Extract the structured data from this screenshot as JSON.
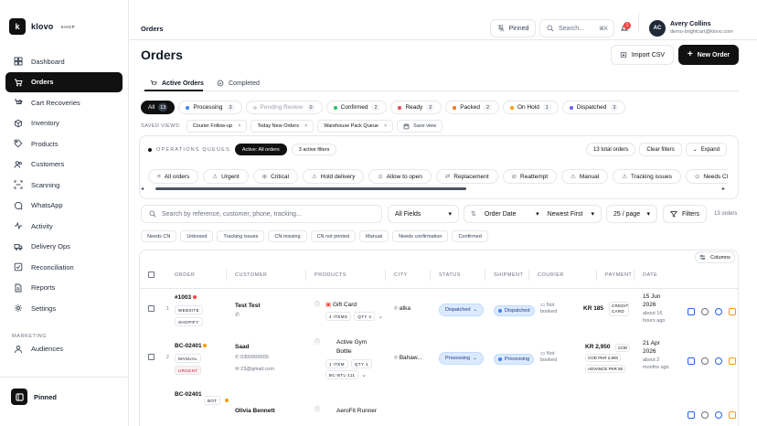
{
  "brand": {
    "name": "klovo",
    "sub": "SHOP",
    "initial": "k"
  },
  "nav": [
    {
      "label": "Dashboard",
      "icon": "grid-icon"
    },
    {
      "label": "Orders",
      "icon": "cart-icon",
      "active": true
    },
    {
      "label": "Cart Recoveries",
      "icon": "cart-recover-icon"
    },
    {
      "label": "Inventory",
      "icon": "box-icon"
    },
    {
      "label": "Products",
      "icon": "tag-icon"
    },
    {
      "label": "Customers",
      "icon": "users-icon"
    },
    {
      "label": "Scanning",
      "icon": "scan-icon"
    },
    {
      "label": "WhatsApp",
      "icon": "chat-icon"
    },
    {
      "label": "Activity",
      "icon": "activity-icon"
    },
    {
      "label": "Delivery Ops",
      "icon": "truck-icon"
    },
    {
      "label": "Reconciliation",
      "icon": "reconcile-icon"
    },
    {
      "label": "Reports",
      "icon": "report-icon"
    },
    {
      "label": "Settings",
      "icon": "gear-icon"
    }
  ],
  "marketing_label": "MARKETING",
  "audiences": "Audiences",
  "pinned_label": "Pinned",
  "topbar": {
    "crumb": "Orders",
    "pinned": "Pinned",
    "search_placeholder": "Search...",
    "shortcut": "⌘K",
    "notif_count": "1",
    "user_name": "Avery Collins",
    "user_email": "demo-brightcart@klovo.com",
    "user_initials": "AC"
  },
  "page": {
    "title": "Orders",
    "import": "Import CSV",
    "new_order": "New Order"
  },
  "tabs": [
    {
      "label": "Active Orders",
      "active": true
    },
    {
      "label": "Completed"
    }
  ],
  "status_pills": [
    {
      "label": "All",
      "count": "13",
      "active": true
    },
    {
      "label": "Processing",
      "count": "3",
      "color": "#3b82f6"
    },
    {
      "label": "Pending Review",
      "count": "0",
      "color": "#d1d5db",
      "faded": true
    },
    {
      "label": "Confirmed",
      "count": "2",
      "color": "#22c55e"
    },
    {
      "label": "Ready",
      "count": "2",
      "color": "#ef4444"
    },
    {
      "label": "Packed",
      "count": "2",
      "color": "#f97316"
    },
    {
      "label": "On Hold",
      "count": "1",
      "color": "#f59e0b"
    },
    {
      "label": "Dispatched",
      "count": "3",
      "color": "#6366f1"
    }
  ],
  "saved_views": {
    "label": "SAVED VIEWS:",
    "views": [
      "Courier Follow-up",
      "Today New Orders",
      "Warehouse Pack Queue"
    ],
    "save": "Save view"
  },
  "queues": {
    "label": "OPERATIONS QUEUES",
    "active": "Active: All orders",
    "filters": "3 active filters",
    "total": "13 total orders",
    "clear": "Clear filters",
    "expand": "Expand",
    "chips": [
      "All orders",
      "Urgent",
      "Critical",
      "Hold delivery",
      "Allow to open",
      "Replacement",
      "Reattempt",
      "Manual",
      "Tracking issues",
      "Needs CN"
    ]
  },
  "search": {
    "placeholder": "Search by reference, customer, phone, tracking...",
    "fields": "All Fields",
    "sort": "Order Date",
    "order": "Newest First",
    "per_page": "25 / page",
    "filters": "Filters",
    "count": "13 orders"
  },
  "quick_filters": [
    "Needs CN",
    "Unboxed",
    "Tracking issues",
    "CN missing",
    "CN not printed",
    "Manual",
    "Needs confirmation",
    "Confirmed"
  ],
  "columns_btn": "Columns",
  "headers": [
    "ORDER",
    "CUSTOMER",
    "PRODUCTS",
    "CITY",
    "STATUS",
    "SHIPMENT",
    "COURIER",
    "PAYMENT",
    "DATE"
  ],
  "rows": [
    {
      "n": "1",
      "id": "#1003",
      "tags": [
        "WEBSITE",
        "SHOPIFY"
      ],
      "customer": "Test Test",
      "phone": "",
      "email": "",
      "product": "Gift Card",
      "items": "4 ITEMS",
      "qty": "QTY 4",
      "sku": "",
      "city": "atka",
      "status": "Dispatched",
      "shipment": "Dispatched",
      "courier": "Not booked",
      "pay": "KR 185",
      "pay_method": "CREDIT CARD",
      "pay_extra": "",
      "date": "15 Jun 2026",
      "ago": "about 16 hours ago"
    },
    {
      "n": "2",
      "id": "BC-02401",
      "tags": [
        "MANUAL",
        "URGENT"
      ],
      "customer": "Saad",
      "phone": "0300000000",
      "email": "23@gmail.com",
      "product": "Active Gym Bottle",
      "items": "1 ITEM",
      "qty": "QTY 1",
      "sku": "BC-BTL-111",
      "city": "Bahaw...",
      "status": "Processing",
      "shipment": "Processing",
      "courier": "Not booked",
      "pay": "KR 2,950",
      "pay_method": "COD",
      "pay_extra": "COD PKR 2,900",
      "pay_extra2": "ADVANCE PKR 50",
      "date": "21 Apr 2026",
      "ago": "about 2 months ago"
    },
    {
      "n": "3",
      "id": "BC-02401",
      "tags": [
        "BOT"
      ],
      "customer": "Olivia Bennett",
      "product": "AeroFit Runner",
      "date": ""
    }
  ]
}
